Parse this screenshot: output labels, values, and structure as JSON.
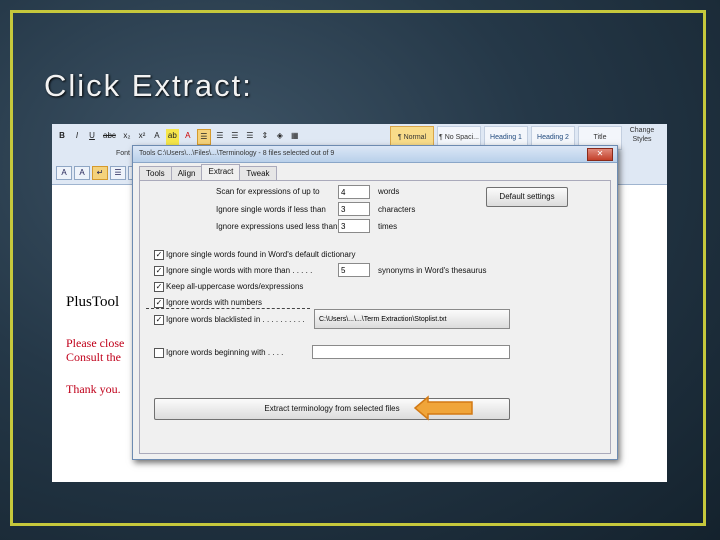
{
  "slide_title": "Click Extract:",
  "colors": {
    "frame": "#c6c83c",
    "arrow_fill": "#f0a53a",
    "arrow_stroke": "#d37a15",
    "doc_red": "#c0001a"
  },
  "ribbon": {
    "format_buttons": [
      "B",
      "I",
      "U",
      "abc",
      "x₂",
      "x²",
      "A",
      "ab",
      "A",
      "A"
    ],
    "font_group_label": "Font",
    "tool_buttons": [
      "A",
      "A",
      "↵",
      "☰",
      "☰"
    ],
    "styles": [
      "¶ Normal",
      "¶ No Spaci...",
      "Heading 1",
      "Heading 2",
      "Title"
    ],
    "change_styles": "Change Styles"
  },
  "document": {
    "line1": "PlusTool",
    "line2": "Please close",
    "line3": "Consult the",
    "line4": "Thank you."
  },
  "dialog": {
    "title": "Tools  C:\\Users\\...\\Files\\...\\Terminology  -  8 files selected out of 9",
    "close": "✕",
    "tabs": [
      "Tools",
      "Align",
      "Extract",
      "Tweak"
    ],
    "active_tab": "Extract",
    "scan_label": "Scan for expressions of up to",
    "scan_value": "4",
    "scan_unit": "words",
    "ignore_short_label": "Ignore single words if less than",
    "ignore_short_value": "3",
    "ignore_short_unit": "characters",
    "ignore_expr_label": "Ignore expressions used less than",
    "ignore_expr_value": "3",
    "ignore_expr_unit": "times",
    "default_settings": "Default settings",
    "opt1": "Ignore single words found in Word's default dictionary",
    "opt2_label": "Ignore single words with more than . . . . .",
    "opt2_value": "5",
    "opt2_unit": "synonyms in Word's thesaurus",
    "opt3": "Keep all-uppercase words/expressions",
    "opt4": "Ignore words with numbers",
    "opt5_label": "Ignore words blacklisted in . . . . . . . . . .",
    "opt5_path": "C:\\Users\\...\\...\\Term Extraction\\Stoplist.txt",
    "opt6_label": "Ignore words beginning with . . . .",
    "opt6_value": "",
    "extract_button": "Extract terminology from selected files"
  }
}
